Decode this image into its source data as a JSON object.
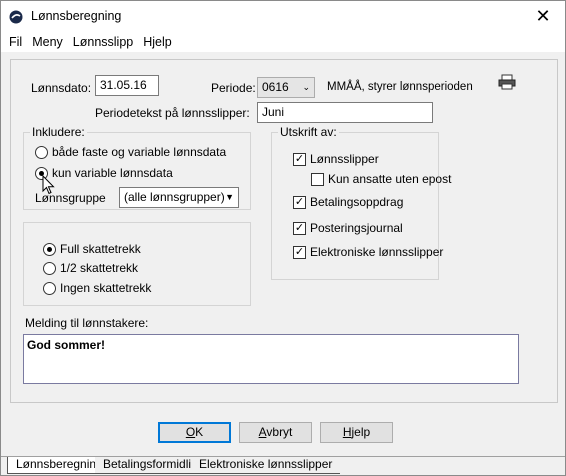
{
  "window": {
    "title": "Lønnsberegning",
    "close_label": "✕"
  },
  "menu": [
    "Fil",
    "Meny",
    "Lønnsslipp",
    "Hjelp"
  ],
  "form": {
    "lonnsdato_label": "Lønnsdato:",
    "lonnsdato_value": "31.05.16",
    "periode_label": "Periode:",
    "periode_value": "0616",
    "periode_hint": "MMÅÅ, styrer lønnsperioden",
    "periodetekst_label": "Periodetekst på lønnsslipper:",
    "periodetekst_value": "Juni"
  },
  "inkludere": {
    "title": "Inkludere:",
    "options": [
      "både faste og variable lønnsdata",
      "kun variable lønnsdata"
    ],
    "selected_index": 1,
    "lonnsgruppe_label": "Lønnsgruppe",
    "lonnsgruppe_value": "(alle lønnsgrupper)"
  },
  "skattetrekk": {
    "options": [
      "Full skattetrekk",
      "1/2 skattetrekk",
      "Ingen skattetrekk"
    ],
    "selected_index": 0
  },
  "utskrift": {
    "title": "Utskrift av:",
    "items": [
      {
        "label": "Lønnsslipper",
        "checked": true
      },
      {
        "label": "Kun ansatte uten epost",
        "checked": false
      },
      {
        "label": "Betalingsoppdrag",
        "checked": true
      },
      {
        "label": "Posteringsjournal",
        "checked": true
      },
      {
        "label": "Elektroniske lønnsslipper",
        "checked": true
      }
    ]
  },
  "melding": {
    "label": "Melding til lønnstakere:",
    "value": "God sommer!"
  },
  "buttons": {
    "ok_u": "O",
    "ok_rest": "K",
    "avbryt_u": "A",
    "avbryt_rest": "vbryt",
    "hjelp_u": "H",
    "hjelp_rest": "jelp"
  },
  "tabs": [
    "Lønnsberegning",
    "Betalingsformidling",
    "Elektroniske lønnsslipper"
  ],
  "colors": {
    "accent": "#0078d7",
    "background": "#f0f0f0"
  }
}
